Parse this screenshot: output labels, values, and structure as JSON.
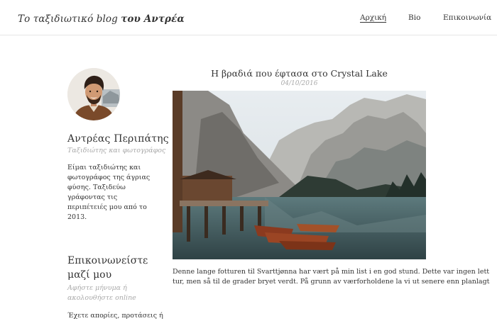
{
  "header": {
    "brand_light": "Το ταξιδιωτικό blog",
    "brand_bold": "του Αντρέα",
    "nav": [
      {
        "label": "Αρχική",
        "active": true
      },
      {
        "label": "Βio",
        "active": false
      },
      {
        "label": "Επικοινωνία",
        "active": false
      }
    ]
  },
  "sidebar": {
    "author": {
      "name": "Αντρέας Περιπάτης",
      "subtitle": "Ταξιδιώτης και φωτογράφος",
      "bio": "Είμαι ταξιδιώτης και φωτογράφος της άγριας φύσης. Ταξιδεύω γράφοντας τις περιπέτειές μου από το 2013."
    },
    "contact": {
      "title": "Επικοινωνείστε μαζί μου",
      "subtitle": "Αφήστε μήνυμα ή ακολουθήστε online",
      "text": "Έχετε απορίες, προτάσεις ή"
    }
  },
  "post": {
    "title": "Η βραδιά που έφτασα στο Crystal Lake",
    "date": "04/10/2016",
    "body_line1": "Denne lange fotturen til Svarttjønna har vært på min list i en god stund. Dette var ingen lett",
    "body_line2": "tur, men så til de grader bryet verdt. På grunn av værforholdene la vi ut senere enn planlagt"
  }
}
